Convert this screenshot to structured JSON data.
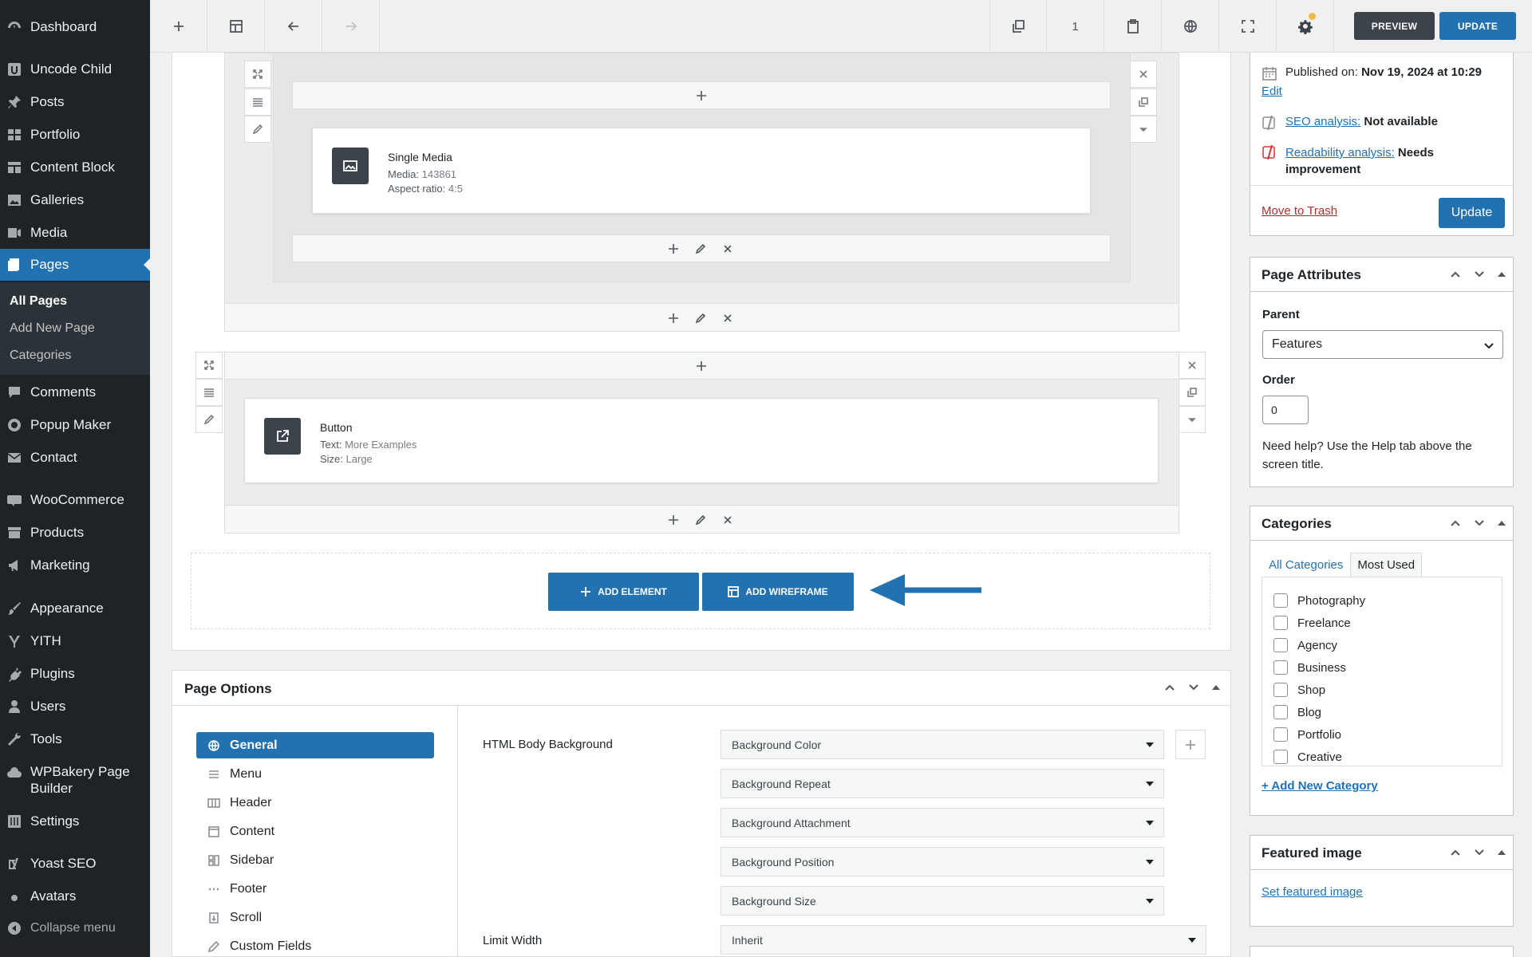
{
  "sidebar": {
    "items": [
      {
        "label": "Dashboard",
        "icon": "dashboard-icon"
      },
      {
        "label": "Uncode Child",
        "icon": "uncode-icon"
      },
      {
        "label": "Posts",
        "icon": "pin-icon"
      },
      {
        "label": "Portfolio",
        "icon": "grid-icon"
      },
      {
        "label": "Content Block",
        "icon": "layout-icon"
      },
      {
        "label": "Galleries",
        "icon": "gallery-icon"
      },
      {
        "label": "Media",
        "icon": "media-icon"
      },
      {
        "label": "Pages",
        "icon": "pages-icon"
      },
      {
        "label": "Comments",
        "icon": "comment-icon"
      },
      {
        "label": "Popup Maker",
        "icon": "popup-icon"
      },
      {
        "label": "Contact",
        "icon": "mail-icon"
      },
      {
        "label": "WooCommerce",
        "icon": "woo-icon"
      },
      {
        "label": "Products",
        "icon": "archive-icon"
      },
      {
        "label": "Marketing",
        "icon": "megaphone-icon"
      },
      {
        "label": "Appearance",
        "icon": "brush-icon"
      },
      {
        "label": "YITH",
        "icon": "yith-icon"
      },
      {
        "label": "Plugins",
        "icon": "plugin-icon"
      },
      {
        "label": "Users",
        "icon": "user-icon"
      },
      {
        "label": "Tools",
        "icon": "wrench-icon"
      },
      {
        "label": "WPBakery Page Builder",
        "icon": "cloud-icon"
      },
      {
        "label": "Settings",
        "icon": "sliders-icon"
      },
      {
        "label": "Yoast SEO",
        "icon": "yoast-icon"
      },
      {
        "label": "Avatars",
        "icon": "avatar-icon"
      }
    ],
    "submenu": [
      "All Pages",
      "Add New Page",
      "Categories"
    ],
    "collapse_label": "Collapse menu"
  },
  "toolbar": {
    "page_count": "1",
    "preview_label": "PREVIEW",
    "update_label": "UPDATE"
  },
  "builder": {
    "media_element": {
      "title": "Single Media",
      "media_key": "Media:",
      "media_val": "143861",
      "ratio_key": "Aspect ratio:",
      "ratio_val": "4:5"
    },
    "button_element": {
      "title": "Button",
      "text_key": "Text:",
      "text_val": "More Examples",
      "size_key": "Size:",
      "size_val": "Large"
    },
    "add_element_label": "ADD ELEMENT",
    "add_wireframe_label": "ADD WIREFRAME"
  },
  "page_options": {
    "title": "Page Options",
    "nav": [
      {
        "label": "General",
        "icon": "globe-icon"
      },
      {
        "label": "Menu",
        "icon": "menu-icon"
      },
      {
        "label": "Header",
        "icon": "columns-icon"
      },
      {
        "label": "Content",
        "icon": "content-icon"
      },
      {
        "label": "Sidebar",
        "icon": "sidebar-icon"
      },
      {
        "label": "Footer",
        "icon": "dots-icon"
      },
      {
        "label": "Scroll",
        "icon": "scroll-icon"
      },
      {
        "label": "Custom Fields",
        "icon": "pencil-icon"
      }
    ],
    "html_body_bg_label": "HTML Body Background",
    "selects": [
      "Background Color",
      "Background Repeat",
      "Background Attachment",
      "Background Position",
      "Background Size"
    ],
    "limit_width_label": "Limit Width",
    "limit_width_value": "Inherit"
  },
  "publish": {
    "published_label": "Published on:",
    "published_date": "Nov 19, 2024 at 10:29",
    "edit_link": "Edit",
    "seo_link": "SEO analysis:",
    "seo_value": "Not available",
    "readability_link": "Readability analysis:",
    "readability_value": "Needs improvement",
    "trash_link": "Move to Trash",
    "update_button": "Update"
  },
  "page_attributes": {
    "title": "Page Attributes",
    "parent_label": "Parent",
    "parent_value": "Features",
    "order_label": "Order",
    "order_value": "0",
    "help_text": "Need help? Use the Help tab above the screen title."
  },
  "categories": {
    "title": "Categories",
    "tab_all": "All Categories",
    "tab_most_used": "Most Used",
    "items": [
      "Photography",
      "Freelance",
      "Agency",
      "Business",
      "Shop",
      "Blog",
      "Portfolio",
      "Creative"
    ],
    "add_new_link": "+ Add New Category"
  },
  "featured_image": {
    "title": "Featured image",
    "set_link": "Set featured image"
  },
  "colors": {
    "accent": "#2271b1",
    "sidebar_bg": "#1d2327",
    "preview_bg": "#3c434a",
    "notice_dot": "#f0b849",
    "trash": "#b32d2e",
    "yoast_bad": "#dc3232"
  }
}
